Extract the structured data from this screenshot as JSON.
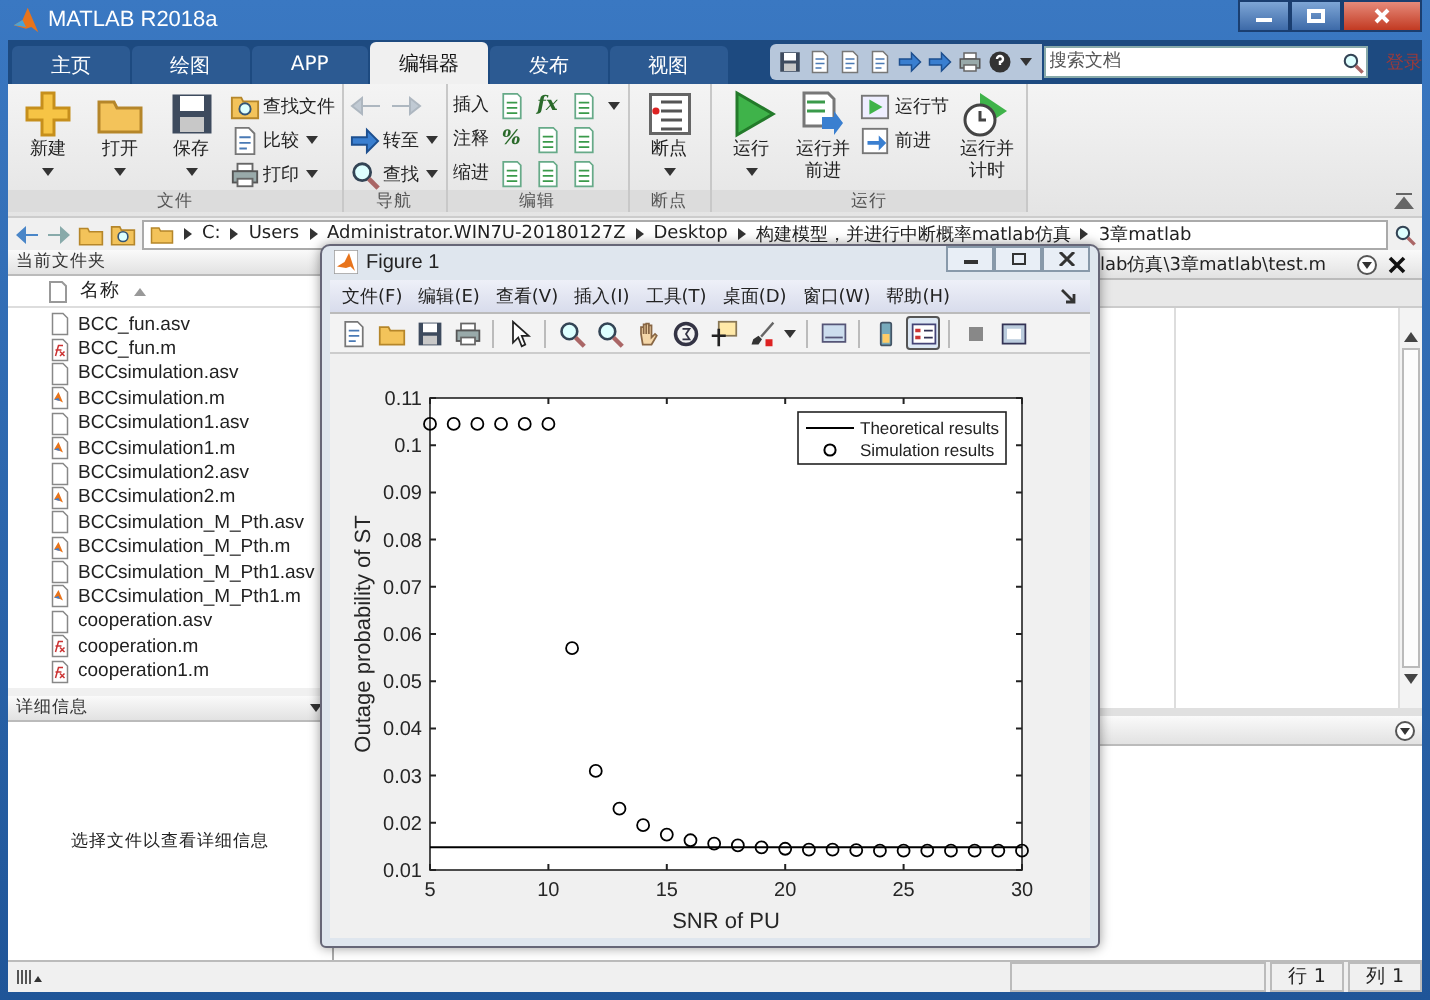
{
  "window": {
    "title": "MATLAB R2018a"
  },
  "tabs": [
    {
      "label": "主页",
      "selected": false
    },
    {
      "label": "绘图",
      "selected": false
    },
    {
      "label": "APP",
      "selected": false
    },
    {
      "label": "编辑器",
      "selected": true
    },
    {
      "label": "发布",
      "selected": false
    },
    {
      "label": "视图",
      "selected": false
    }
  ],
  "search": {
    "placeholder": "搜索文档"
  },
  "login": "登录",
  "ribbon": {
    "groups": [
      {
        "label": "文件",
        "items": [
          {
            "kind": "large",
            "label": "新建",
            "dropdown": true
          },
          {
            "kind": "large",
            "label": "打开",
            "dropdown": true
          },
          {
            "kind": "large",
            "label": "保存",
            "dropdown": true
          },
          {
            "kind": "stack",
            "items": [
              {
                "label": "查找文件",
                "dropdown": false
              },
              {
                "label": "比较",
                "dropdown": true
              },
              {
                "label": "打印",
                "dropdown": true
              }
            ]
          }
        ]
      },
      {
        "label": "导航",
        "items": [
          {
            "kind": "stack",
            "items": [
              {
                "kind": "arrows",
                "disabled": true
              },
              {
                "label": "转至",
                "dropdown": true
              },
              {
                "label": "查找",
                "dropdown": true
              }
            ]
          }
        ]
      },
      {
        "label": "编辑",
        "items": [
          {
            "kind": "grid",
            "rows": [
              {
                "label": "插入",
                "cells": [
                  {
                    "kind": "icon"
                  },
                  {
                    "kind": "glyph",
                    "text": "fx"
                  },
                  {
                    "kind": "icon"
                  }
                ],
                "dropdown": true
              },
              {
                "label": "注释",
                "cells": [
                  {
                    "kind": "glyph",
                    "text": "%"
                  },
                  {
                    "kind": "icon"
                  },
                  {
                    "kind": "icon"
                  }
                ],
                "dropdown": false
              },
              {
                "label": "缩进",
                "cells": [
                  {
                    "kind": "icon"
                  },
                  {
                    "kind": "icon"
                  },
                  {
                    "kind": "icon"
                  }
                ],
                "dropdown": false
              }
            ]
          }
        ]
      },
      {
        "label": "断点",
        "items": [
          {
            "kind": "large",
            "label": "断点",
            "dropdown": true
          }
        ]
      },
      {
        "label": "运行",
        "items": [
          {
            "kind": "large",
            "label": "运行",
            "dropdown": true
          },
          {
            "kind": "large",
            "label": "运行并前进",
            "dropdown": false
          },
          {
            "kind": "stack",
            "items": [
              {
                "label": "运行节",
                "dropdown": false
              },
              {
                "label": "前进",
                "dropdown": false
              }
            ]
          },
          {
            "kind": "large",
            "label": "运行并计时",
            "dropdown": false
          }
        ]
      }
    ]
  },
  "path": [
    "C:",
    "Users",
    "Administrator.WIN7U-20180127Z",
    "Desktop",
    "构建模型，并进行中断概率matlab仿真",
    "3章matlab"
  ],
  "current_folder": {
    "title": "当前文件夹",
    "column": "名称",
    "files": [
      {
        "name": "BCC_fun.asv",
        "kind": "asv"
      },
      {
        "name": "BCC_fun.m",
        "kind": "function"
      },
      {
        "name": "BCCsimulation.asv",
        "kind": "asv"
      },
      {
        "name": "BCCsimulation.m",
        "kind": "script"
      },
      {
        "name": "BCCsimulation1.asv",
        "kind": "asv"
      },
      {
        "name": "BCCsimulation1.m",
        "kind": "script"
      },
      {
        "name": "BCCsimulation2.asv",
        "kind": "asv"
      },
      {
        "name": "BCCsimulation2.m",
        "kind": "script"
      },
      {
        "name": "BCCsimulation_M_Pth.asv",
        "kind": "asv"
      },
      {
        "name": "BCCsimulation_M_Pth.m",
        "kind": "script"
      },
      {
        "name": "BCCsimulation_M_Pth1.asv",
        "kind": "asv"
      },
      {
        "name": "BCCsimulation_M_Pth1.m",
        "kind": "script"
      },
      {
        "name": "cooperation.asv",
        "kind": "asv"
      },
      {
        "name": "cooperation.m",
        "kind": "function"
      },
      {
        "name": "cooperation1.m",
        "kind": "function"
      }
    ]
  },
  "details": {
    "title": "详细信息",
    "message": "选择文件以查看详细信息"
  },
  "editor": {
    "title": "lab仿真\\3章matlab\\test.m"
  },
  "status_bar": {
    "line": "行 1",
    "column": "列 1"
  },
  "figure": {
    "title": "Figure 1",
    "menu": [
      "文件(F)",
      "编辑(E)",
      "查看(V)",
      "插入(I)",
      "工具(T)",
      "桌面(D)",
      "窗口(W)",
      "帮助(H)"
    ],
    "toolbar": [
      [
        {
          "selected": false
        },
        {
          "selected": false
        },
        {
          "selected": false
        },
        {
          "selected": false
        }
      ],
      [
        {
          "selected": false
        }
      ],
      [
        {
          "selected": false
        },
        {
          "selected": false
        },
        {
          "selected": false
        },
        {
          "selected": false
        },
        {
          "selected": false
        },
        {
          "selected": false
        }
      ],
      [
        {
          "selected": false
        }
      ],
      [
        {
          "selected": false
        },
        {
          "selected": true
        }
      ],
      [
        {
          "selected": false
        },
        {
          "selected": false
        }
      ]
    ],
    "chart_data": {
      "type": "scatter",
      "xlabel": "SNR of PU",
      "ylabel": "Outage probability of ST",
      "x": [
        5,
        6,
        7,
        8,
        9,
        10,
        11,
        12,
        13,
        14,
        15,
        16,
        17,
        18,
        19,
        20,
        21,
        22,
        23,
        24,
        25,
        26,
        27,
        28,
        29,
        30
      ],
      "xlim": [
        5,
        30
      ],
      "ylim": [
        0.01,
        0.11
      ],
      "xticks": [
        5,
        10,
        15,
        20,
        25,
        30
      ],
      "yticks": [
        0.01,
        0.02,
        0.03,
        0.04,
        0.05,
        0.06,
        0.07,
        0.08,
        0.09,
        0.1,
        0.11
      ],
      "legend": true,
      "ref_lines": [
        {
          "axis": "y",
          "value": 0.0148,
          "label": "Theoretical results",
          "color": "#000000"
        }
      ],
      "series": [
        {
          "name": "Simulation results",
          "color": "#000000",
          "marker": "o",
          "values": [
            0.1045,
            0.1045,
            0.1045,
            0.1045,
            0.1045,
            0.1045,
            0.057,
            0.031,
            0.023,
            0.0195,
            0.0175,
            0.0163,
            0.0156,
            0.0152,
            0.0148,
            0.0145,
            0.0143,
            0.0143,
            0.0142,
            0.0141,
            0.0141,
            0.0141,
            0.0141,
            0.0141,
            0.0141,
            0.0141
          ]
        }
      ]
    }
  }
}
